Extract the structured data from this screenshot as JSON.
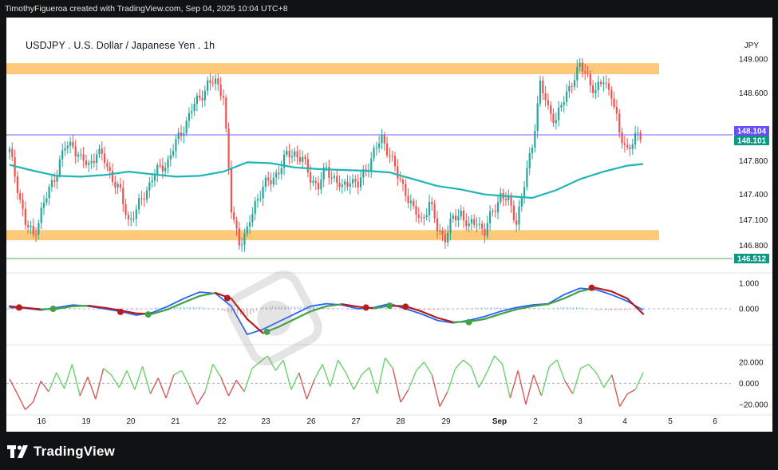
{
  "header": {
    "attribution": "TimothyFigueroa created with TradingView.com, Sep 04, 2025 10:04 UTC+8"
  },
  "chart": {
    "title": "USDJPY . U.S. Dollar / Japanese Yen . 1h",
    "currency": "JPY"
  },
  "footer": {
    "brand": "TradingView"
  },
  "colors": {
    "background": "#ffffff",
    "candle_up": "#26a69a",
    "candle_down": "#ef5350",
    "moving_average": "#1fb5b5",
    "zone": "#ffb74d",
    "price_line": "#7b61ff",
    "current_price": "#089981",
    "support_line": "#4caf50",
    "macd_line": "#2962ff",
    "signal_up": "#43a047",
    "signal_down": "#b71c1c",
    "osc_up": "#6bd26b",
    "osc_down": "#d65a5a"
  },
  "chart_data": [
    {
      "type": "candlestick",
      "title": "USDJPY . U.S. Dollar / Japanese Yen . 1h",
      "ylim": [
        146.55,
        149.3
      ],
      "y_ticks": [
        "149.000",
        "148.600",
        "147.800",
        "147.400",
        "147.100",
        "146.800"
      ],
      "y_tick_values": [
        149.0,
        148.6,
        147.8,
        147.4,
        147.1,
        146.8
      ],
      "x_ticks": [
        "16",
        "19",
        "20",
        "21",
        "22",
        "23",
        "26",
        "27",
        "28",
        "29",
        "Sep",
        "2",
        "3",
        "4",
        "5",
        "6"
      ],
      "price_badges": [
        {
          "label": "148.104",
          "value": 148.104,
          "kind": "price-line"
        },
        {
          "label": "148.101",
          "value": 148.101,
          "kind": "current"
        },
        {
          "label": "146.512",
          "value": 146.512,
          "kind": "support"
        }
      ],
      "zones": [
        {
          "name": "resistance-zone",
          "from": 148.82,
          "to": 148.95
        },
        {
          "name": "support-zone",
          "from": 146.86,
          "to": 146.98
        }
      ],
      "moving_average": [
        [
          0,
          147.75
        ],
        [
          3,
          147.68
        ],
        [
          6,
          147.62
        ],
        [
          9,
          147.61
        ],
        [
          12,
          147.63
        ],
        [
          15,
          147.67
        ],
        [
          18,
          147.64
        ],
        [
          21,
          147.61
        ],
        [
          24,
          147.62
        ],
        [
          27,
          147.67
        ],
        [
          30,
          147.78
        ],
        [
          33,
          147.77
        ],
        [
          36,
          147.72
        ],
        [
          39,
          147.7
        ],
        [
          42,
          147.69
        ],
        [
          45,
          147.68
        ],
        [
          48,
          147.66
        ],
        [
          51,
          147.58
        ],
        [
          54,
          147.5
        ],
        [
          57,
          147.46
        ],
        [
          60,
          147.4
        ],
        [
          63,
          147.38
        ],
        [
          66,
          147.36
        ],
        [
          69,
          147.45
        ],
        [
          72,
          147.58
        ],
        [
          75,
          147.67
        ],
        [
          78,
          147.74
        ],
        [
          80,
          147.76
        ]
      ],
      "anchors": [
        [
          0,
          147.9
        ],
        [
          1,
          147.5
        ],
        [
          2,
          147.05
        ],
        [
          3,
          146.92
        ],
        [
          4,
          147.2
        ],
        [
          5,
          147.45
        ],
        [
          6,
          147.7
        ],
        [
          7,
          147.95
        ],
        [
          8,
          148.0
        ],
        [
          9,
          147.8
        ],
        [
          10,
          147.75
        ],
        [
          11,
          147.9
        ],
        [
          12,
          147.8
        ],
        [
          13,
          147.6
        ],
        [
          14,
          147.4
        ],
        [
          15,
          147.1
        ],
        [
          16,
          147.2
        ],
        [
          17,
          147.4
        ],
        [
          18,
          147.6
        ],
        [
          19,
          147.7
        ],
        [
          20,
          147.8
        ],
        [
          21,
          148.0
        ],
        [
          22,
          148.2
        ],
        [
          23,
          148.4
        ],
        [
          24,
          148.55
        ],
        [
          25,
          148.7
        ],
        [
          26,
          148.72
        ],
        [
          27,
          148.6
        ],
        [
          28,
          147.2
        ],
        [
          29,
          146.85
        ],
        [
          30,
          146.95
        ],
        [
          31,
          147.3
        ],
        [
          32,
          147.5
        ],
        [
          33,
          147.55
        ],
        [
          34,
          147.7
        ],
        [
          35,
          147.85
        ],
        [
          36,
          147.9
        ],
        [
          37,
          147.8
        ],
        [
          38,
          147.6
        ],
        [
          39,
          147.5
        ],
        [
          40,
          147.7
        ],
        [
          41,
          147.6
        ],
        [
          42,
          147.45
        ],
        [
          43,
          147.6
        ],
        [
          44,
          147.5
        ],
        [
          45,
          147.7
        ],
        [
          46,
          147.9
        ],
        [
          47,
          148.05
        ],
        [
          48,
          147.9
        ],
        [
          49,
          147.6
        ],
        [
          50,
          147.45
        ],
        [
          51,
          147.2
        ],
        [
          52,
          147.1
        ],
        [
          53,
          147.3
        ],
        [
          54,
          147.0
        ],
        [
          55,
          146.9
        ],
        [
          56,
          147.1
        ],
        [
          57,
          147.2
        ],
        [
          58,
          147.0
        ],
        [
          59,
          147.1
        ],
        [
          60,
          146.95
        ],
        [
          61,
          147.2
        ],
        [
          62,
          147.4
        ],
        [
          63,
          147.3
        ],
        [
          64,
          147.1
        ],
        [
          65,
          147.5
        ],
        [
          66,
          148.0
        ],
        [
          67,
          148.7
        ],
        [
          68,
          148.4
        ],
        [
          69,
          148.3
        ],
        [
          70,
          148.5
        ],
        [
          71,
          148.75
        ],
        [
          72,
          148.9
        ],
        [
          73,
          148.8
        ],
        [
          74,
          148.6
        ],
        [
          75,
          148.75
        ],
        [
          76,
          148.6
        ],
        [
          77,
          148.1
        ],
        [
          78,
          147.95
        ],
        [
          79,
          148.05
        ],
        [
          80,
          148.1
        ]
      ]
    },
    {
      "type": "line",
      "name": "macd",
      "ylim": [
        -1.4,
        1.4
      ],
      "y_ticks": [
        "1.000",
        "0.000"
      ],
      "y_tick_values": [
        1.0,
        0.0
      ],
      "macd": [
        [
          0,
          0.05
        ],
        [
          2,
          0.02
        ],
        [
          4,
          -0.05
        ],
        [
          6,
          0.05
        ],
        [
          8,
          0.15
        ],
        [
          10,
          0.1
        ],
        [
          12,
          0.0
        ],
        [
          14,
          -0.1
        ],
        [
          16,
          -0.25
        ],
        [
          18,
          -0.15
        ],
        [
          20,
          0.1
        ],
        [
          22,
          0.4
        ],
        [
          24,
          0.65
        ],
        [
          26,
          0.6
        ],
        [
          28,
          0.1
        ],
        [
          30,
          -1.0
        ],
        [
          32,
          -0.8
        ],
        [
          34,
          -0.5
        ],
        [
          36,
          -0.2
        ],
        [
          38,
          0.1
        ],
        [
          40,
          0.2
        ],
        [
          42,
          0.15
        ],
        [
          44,
          0.0
        ],
        [
          46,
          0.05
        ],
        [
          48,
          0.2
        ],
        [
          50,
          0.0
        ],
        [
          52,
          -0.2
        ],
        [
          54,
          -0.45
        ],
        [
          56,
          -0.55
        ],
        [
          58,
          -0.45
        ],
        [
          60,
          -0.3
        ],
        [
          62,
          -0.1
        ],
        [
          64,
          0.05
        ],
        [
          66,
          0.15
        ],
        [
          68,
          0.2
        ],
        [
          70,
          0.55
        ],
        [
          72,
          0.8
        ],
        [
          74,
          0.75
        ],
        [
          76,
          0.55
        ],
        [
          78,
          0.3
        ],
        [
          80,
          -0.05
        ]
      ],
      "signal": [
        [
          0,
          0.1
        ],
        [
          2,
          0.04
        ],
        [
          4,
          -0.02
        ],
        [
          6,
          0.0
        ],
        [
          8,
          0.1
        ],
        [
          10,
          0.12
        ],
        [
          12,
          0.04
        ],
        [
          14,
          -0.06
        ],
        [
          16,
          -0.18
        ],
        [
          18,
          -0.2
        ],
        [
          20,
          -0.02
        ],
        [
          22,
          0.25
        ],
        [
          24,
          0.5
        ],
        [
          26,
          0.62
        ],
        [
          28,
          0.4
        ],
        [
          30,
          -0.4
        ],
        [
          32,
          -0.95
        ],
        [
          34,
          -0.7
        ],
        [
          36,
          -0.4
        ],
        [
          38,
          -0.1
        ],
        [
          40,
          0.1
        ],
        [
          42,
          0.18
        ],
        [
          44,
          0.08
        ],
        [
          46,
          0.02
        ],
        [
          48,
          0.12
        ],
        [
          50,
          0.1
        ],
        [
          52,
          -0.1
        ],
        [
          54,
          -0.35
        ],
        [
          56,
          -0.52
        ],
        [
          58,
          -0.5
        ],
        [
          60,
          -0.4
        ],
        [
          62,
          -0.2
        ],
        [
          64,
          -0.02
        ],
        [
          66,
          0.1
        ],
        [
          68,
          0.18
        ],
        [
          70,
          0.4
        ],
        [
          72,
          0.68
        ],
        [
          74,
          0.82
        ],
        [
          76,
          0.68
        ],
        [
          78,
          0.4
        ],
        [
          80,
          -0.2
        ]
      ],
      "cross_points": [
        [
          1.2,
          0.05,
          "down"
        ],
        [
          5.5,
          0.0,
          "up"
        ],
        [
          14,
          -0.12,
          "down"
        ],
        [
          17.5,
          -0.22,
          "up"
        ],
        [
          27.5,
          0.42,
          "down"
        ],
        [
          32.5,
          -0.9,
          "up"
        ],
        [
          45,
          0.05,
          "down"
        ],
        [
          48,
          0.12,
          "up"
        ],
        [
          50,
          0.08,
          "down"
        ],
        [
          58,
          -0.52,
          "up"
        ],
        [
          73.5,
          0.82,
          "down"
        ]
      ]
    },
    {
      "type": "line",
      "name": "oscillator",
      "ylim": [
        -30,
        35
      ],
      "y_ticks": [
        "20.000",
        "0.000",
        "−20.000"
      ],
      "y_tick_values": [
        20,
        0,
        -20
      ],
      "values": [
        4,
        -10,
        -25,
        -18,
        2,
        -8,
        10,
        -5,
        18,
        -12,
        6,
        -15,
        14,
        8,
        -4,
        12,
        -6,
        16,
        -10,
        5,
        -14,
        8,
        12,
        -3,
        -20,
        -8,
        18,
        6,
        -12,
        3,
        -8,
        14,
        20,
        26,
        12,
        22,
        -6,
        10,
        -15,
        4,
        18,
        -3,
        22,
        10,
        -6,
        8,
        15,
        -10,
        24,
        14,
        -18,
        -6,
        12,
        20,
        8,
        -22,
        -8,
        14,
        22,
        16,
        -4,
        10,
        26,
        18,
        -14,
        12,
        -20,
        8,
        -12,
        16,
        22,
        2,
        -10,
        14,
        18,
        10,
        -4,
        8,
        -22,
        -10,
        -6,
        10
      ]
    }
  ]
}
